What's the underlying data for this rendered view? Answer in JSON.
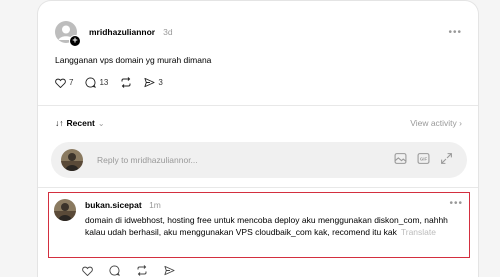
{
  "post": {
    "username": "mridhazuliannor",
    "time": "3d",
    "text": "Langganan vps domain yg murah dimana",
    "likes": "7",
    "comments": "13",
    "shares": "3"
  },
  "thread": {
    "sort_label": "Recent",
    "view_activity": "View activity ›"
  },
  "reply": {
    "placeholder": "Reply to mridhazuliannor..."
  },
  "comment": {
    "username": "bukan.sicepat",
    "time": "1m",
    "text": "domain di idwebhost, hosting free untuk mencoba deploy aku menggunakan diskon_com, nahhh kalau udah berhasil, aku menggunakan VPS cloudbaik_com kak, recomend itu kak",
    "translate": "Translate"
  },
  "colors": {
    "highlight": "#d32f3f",
    "muted": "#999999"
  }
}
